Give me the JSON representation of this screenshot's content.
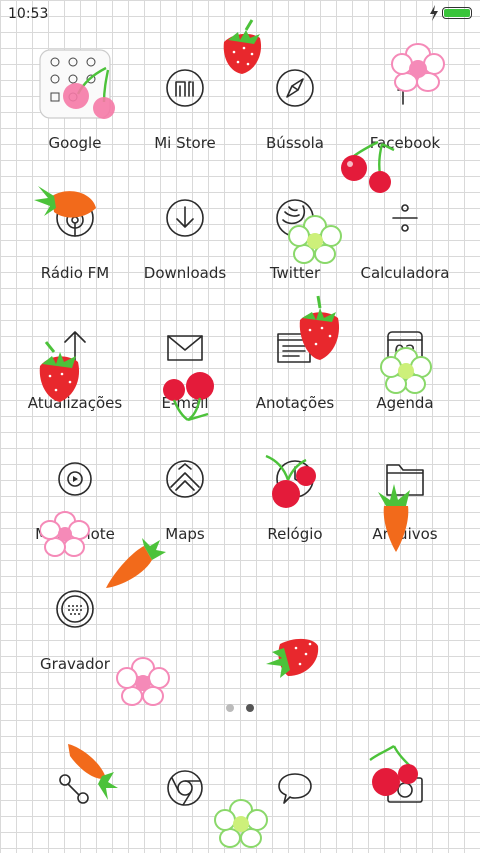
{
  "status": {
    "time": "10:53",
    "battery_color": "#39c53a"
  },
  "apps": [
    {
      "label": "Google",
      "icon": "google-folder-icon"
    },
    {
      "label": "Mi Store",
      "icon": "mi-store-icon"
    },
    {
      "label": "Bússola",
      "icon": "compass-icon"
    },
    {
      "label": "Facebook",
      "icon": "facebook-icon"
    },
    {
      "label": "Rádio FM",
      "icon": "radio-icon"
    },
    {
      "label": "Downloads",
      "icon": "download-icon"
    },
    {
      "label": "Twitter",
      "icon": "twitter-bird-icon"
    },
    {
      "label": "Calculadora",
      "icon": "calculator-icon"
    },
    {
      "label": "Atualizações",
      "icon": "update-arrow-icon"
    },
    {
      "label": "E-mail",
      "icon": "envelope-icon"
    },
    {
      "label": "Anotações",
      "icon": "notes-icon"
    },
    {
      "label": "Agenda",
      "icon": "calendar-icon",
      "badge": "02"
    },
    {
      "label": "Mi Remote",
      "icon": "remote-play-icon"
    },
    {
      "label": "Maps",
      "icon": "map-icon"
    },
    {
      "label": "Relógio",
      "icon": "clock-icon"
    },
    {
      "label": "Arquivos",
      "icon": "folder-icon"
    },
    {
      "label": "Gravador",
      "icon": "recorder-icon"
    }
  ],
  "dock": [
    {
      "icon": "phone-icon"
    },
    {
      "icon": "browser-icon"
    },
    {
      "icon": "messages-icon"
    },
    {
      "icon": "camera-icon"
    }
  ],
  "pager": {
    "pages": 2,
    "current": 2,
    "active_color": "#555555",
    "inactive_color": "#bbbbbb"
  },
  "decor_colors": {
    "strawberry": "#e8282d",
    "leaf": "#4cc23a",
    "cherry": "#e41b3a",
    "carrot": "#f26a1b",
    "flower_pink": "#f58ab8",
    "flower_green": "#8ad86a"
  }
}
